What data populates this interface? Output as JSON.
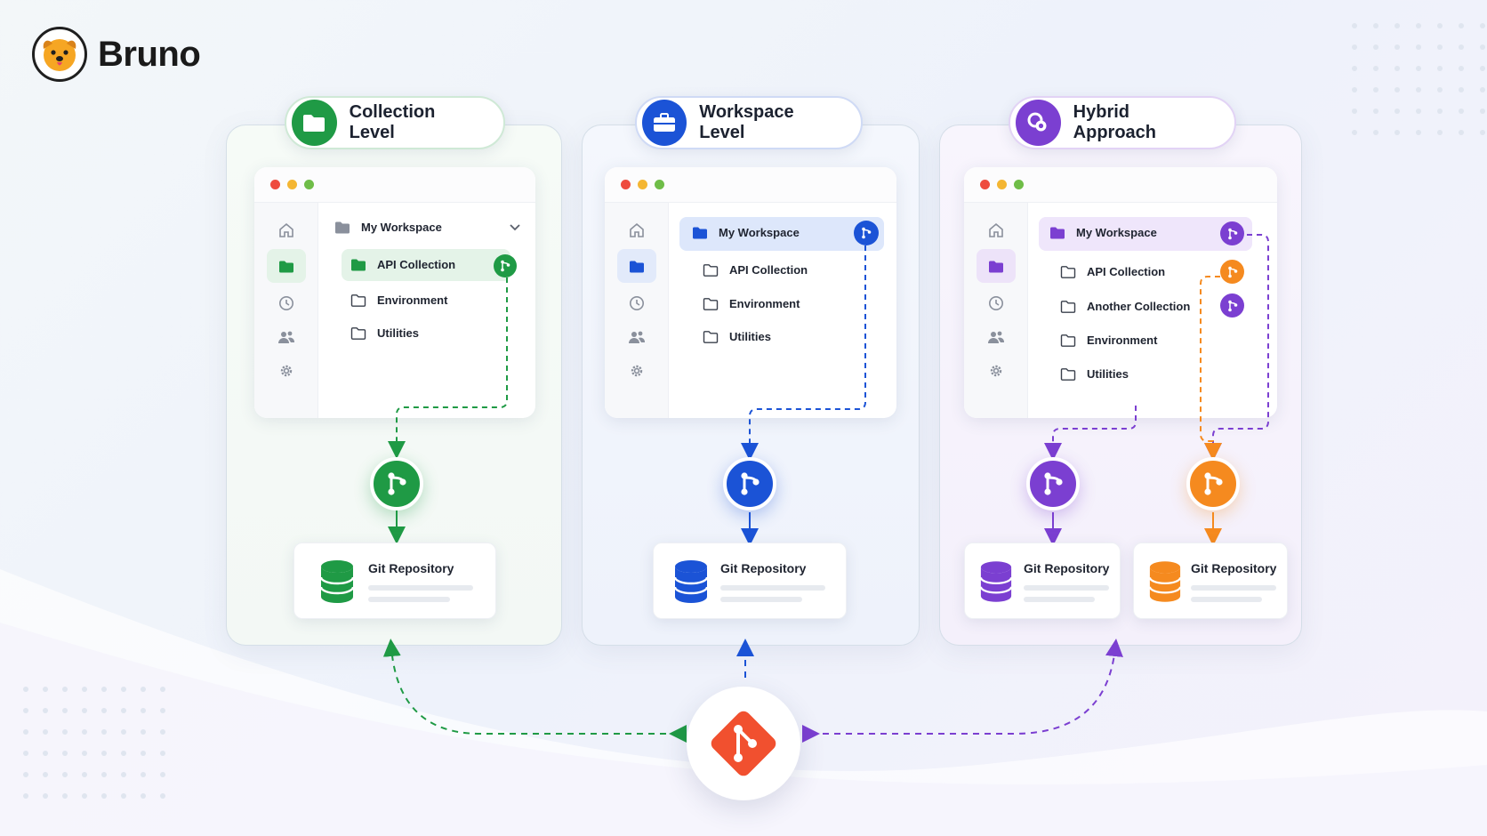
{
  "brand": {
    "name": "Bruno"
  },
  "colors": {
    "green": "#1f9a45",
    "blue": "#1b53d6",
    "purple": "#7b3fd1",
    "orange": "#f58a1f",
    "git_red": "#f1502f"
  },
  "icons": [
    "dog-logo-icon",
    "folder-icon",
    "briefcase-icon",
    "rings-icon",
    "home-icon",
    "clock-icon",
    "users-icon",
    "gear-icon",
    "chevron-down-icon",
    "git-branch-icon",
    "database-icon",
    "git-logo-icon"
  ],
  "columns": [
    {
      "title": "Collection Level",
      "workspace": "My Workspace",
      "items": [
        "API Collection",
        "Environment",
        "Utilities"
      ],
      "repos": [
        "Git Repository"
      ]
    },
    {
      "title": "Workspace Level",
      "workspace": "My Workspace",
      "items": [
        "API Collection",
        "Environment",
        "Utilities"
      ],
      "repos": [
        "Git Repository"
      ]
    },
    {
      "title": "Hybrid Approach",
      "workspace": "My Workspace",
      "items": [
        "API Collection",
        "Another Collection",
        "Environment",
        "Utilities"
      ],
      "repos": [
        "Git Repository",
        "Git Repository"
      ]
    }
  ]
}
